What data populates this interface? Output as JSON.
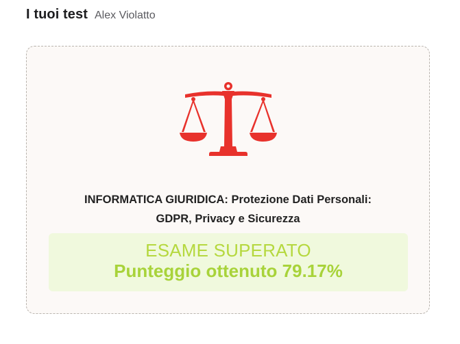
{
  "header": {
    "title": "I tuoi test",
    "user_name": "Alex Violatto"
  },
  "test_card": {
    "icon": "justice-scales-icon",
    "name_line1": "INFORMATICA GIURIDICA: Protezione Dati Personali:",
    "name_line2": "GDPR, Privacy e Sicurezza",
    "result_status": "ESAME SUPERATO",
    "result_score": "Punteggio ottenuto 79.17%",
    "score_percent": 79.17,
    "colors": {
      "icon": "#e8322c",
      "result_text": "#b5d83e",
      "result_background": "#f0f9dd"
    }
  }
}
